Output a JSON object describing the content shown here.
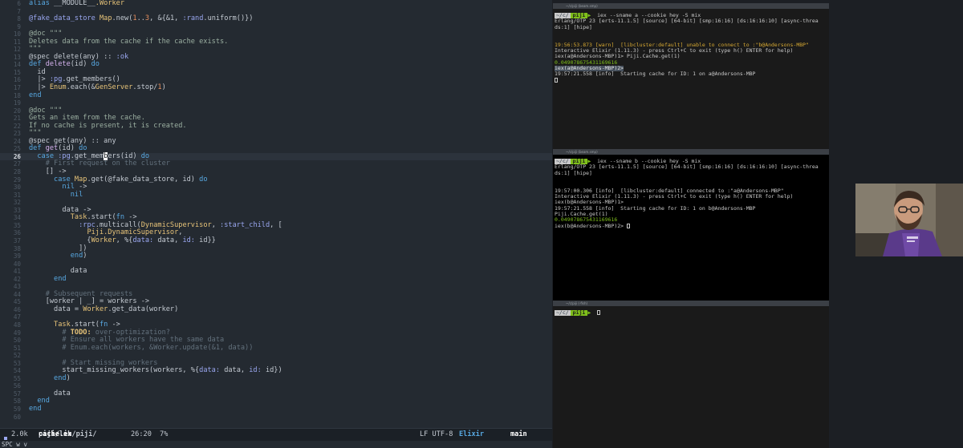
{
  "editor": {
    "lines": [
      {
        "n": "6",
        "t": [
          [
            "alias ",
            "kw"
          ],
          [
            "__MODULE__",
            ""
          ],
          [
            ".Worker",
            "mod"
          ]
        ]
      },
      {
        "n": "7",
        "t": []
      },
      {
        "n": "8",
        "t": [
          [
            "@fake_data_store ",
            "atom"
          ],
          [
            "Map",
            "mod"
          ],
          [
            ".new(",
            ""
          ],
          [
            "1",
            "num"
          ],
          [
            "..",
            ""
          ],
          [
            "3",
            "num"
          ],
          [
            ", &{&1, ",
            ""
          ],
          [
            ":rand",
            "atom"
          ],
          [
            ".uniform()})",
            ""
          ]
        ]
      },
      {
        "n": "9",
        "t": []
      },
      {
        "n": "10",
        "t": [
          [
            "@doc \"\"\"",
            "doc"
          ]
        ]
      },
      {
        "n": "11",
        "t": [
          [
            "Deletes data from the cache if the cache exists.",
            "doc"
          ]
        ]
      },
      {
        "n": "12",
        "t": [
          [
            "\"\"\"",
            "doc"
          ]
        ]
      },
      {
        "n": "13",
        "t": [
          [
            "@spec delete(any) :: ",
            ""
          ],
          [
            ":ok",
            "atom"
          ]
        ]
      },
      {
        "n": "14",
        "t": [
          [
            "def ",
            "kw"
          ],
          [
            "delete",
            "fn"
          ],
          [
            "(id) ",
            ""
          ],
          [
            "do",
            "kw"
          ]
        ]
      },
      {
        "n": "15",
        "t": [
          [
            "  id",
            ""
          ]
        ]
      },
      {
        "n": "16",
        "t": [
          [
            "  |> ",
            ""
          ],
          [
            ":pg",
            "atom"
          ],
          [
            ".get_members()",
            ""
          ]
        ]
      },
      {
        "n": "17",
        "t": [
          [
            "  |> ",
            ""
          ],
          [
            "Enum",
            "mod"
          ],
          [
            ".each(&",
            ""
          ],
          [
            "GenServer",
            "mod"
          ],
          [
            ".stop/",
            ""
          ],
          [
            "1",
            "num"
          ],
          [
            ")",
            ""
          ]
        ]
      },
      {
        "n": "18",
        "t": [
          [
            "end",
            "kw"
          ]
        ]
      },
      {
        "n": "19",
        "t": []
      },
      {
        "n": "20",
        "t": [
          [
            "@doc \"\"\"",
            "doc"
          ]
        ]
      },
      {
        "n": "21",
        "t": [
          [
            "Gets an item from the cache.",
            "doc"
          ]
        ]
      },
      {
        "n": "22",
        "t": [
          [
            "If no cache is present, it is created.",
            "doc"
          ]
        ]
      },
      {
        "n": "23",
        "t": [
          [
            "\"\"\"",
            "doc"
          ]
        ]
      },
      {
        "n": "24",
        "t": [
          [
            "@spec get(any) :: any",
            ""
          ]
        ]
      },
      {
        "n": "25",
        "t": [
          [
            "def ",
            "kw"
          ],
          [
            "get",
            "fn"
          ],
          [
            "(id) ",
            ""
          ],
          [
            "do",
            "kw"
          ]
        ]
      },
      {
        "n": "26",
        "cur": true,
        "t": [
          [
            "  case ",
            "kw"
          ],
          [
            ":pg",
            "atom"
          ],
          [
            ".get_mem",
            ""
          ],
          [
            "b",
            "cur"
          ],
          [
            "ers(id) ",
            ""
          ],
          [
            "do",
            "kw"
          ]
        ]
      },
      {
        "n": "27",
        "t": [
          [
            "    # First request on the cluster",
            "cm"
          ]
        ]
      },
      {
        "n": "28",
        "t": [
          [
            "    [] ->",
            ""
          ]
        ]
      },
      {
        "n": "29",
        "t": [
          [
            "      case ",
            "kw"
          ],
          [
            "Map",
            "mod"
          ],
          [
            ".get(@fake_data_store, id) ",
            ""
          ],
          [
            "do",
            "kw"
          ]
        ]
      },
      {
        "n": "30",
        "t": [
          [
            "        nil ",
            "kw"
          ],
          [
            "->",
            ""
          ]
        ]
      },
      {
        "n": "31",
        "t": [
          [
            "          nil",
            "kw"
          ]
        ]
      },
      {
        "n": "32",
        "t": []
      },
      {
        "n": "33",
        "t": [
          [
            "        data ->",
            ""
          ]
        ]
      },
      {
        "n": "34",
        "t": [
          [
            "          ",
            ""
          ],
          [
            "Task",
            "mod"
          ],
          [
            ".start(",
            ""
          ],
          [
            "fn ",
            "kw"
          ],
          [
            "->",
            ""
          ]
        ]
      },
      {
        "n": "35",
        "t": [
          [
            "            ",
            ""
          ],
          [
            ":rpc",
            "atom"
          ],
          [
            ".multicall(",
            ""
          ],
          [
            "DynamicSupervisor",
            "mod"
          ],
          [
            ", ",
            ""
          ],
          [
            ":start_child",
            "atom"
          ],
          [
            ", [",
            ""
          ]
        ]
      },
      {
        "n": "36",
        "t": [
          [
            "              ",
            ""
          ],
          [
            "Piji.DynamicSupervisor",
            "mod"
          ],
          [
            ",",
            ""
          ]
        ]
      },
      {
        "n": "37",
        "t": [
          [
            "              {",
            ""
          ],
          [
            "Worker",
            "mod"
          ],
          [
            ", %{",
            ""
          ],
          [
            "data:",
            "atom"
          ],
          [
            " data, ",
            ""
          ],
          [
            "id:",
            "atom"
          ],
          [
            " id}}",
            ""
          ]
        ]
      },
      {
        "n": "38",
        "t": [
          [
            "            ])",
            ""
          ]
        ]
      },
      {
        "n": "39",
        "t": [
          [
            "          ",
            ""
          ],
          [
            "end",
            "kw"
          ],
          [
            ")",
            ""
          ]
        ]
      },
      {
        "n": "40",
        "t": []
      },
      {
        "n": "41",
        "t": [
          [
            "          data",
            ""
          ]
        ]
      },
      {
        "n": "42",
        "t": [
          [
            "      ",
            ""
          ],
          [
            "end",
            "kw"
          ]
        ]
      },
      {
        "n": "43",
        "t": []
      },
      {
        "n": "44",
        "t": [
          [
            "    # Subsequent requests",
            "cm"
          ]
        ]
      },
      {
        "n": "45",
        "t": [
          [
            "    [worker | _] = workers ->",
            ""
          ]
        ]
      },
      {
        "n": "46",
        "t": [
          [
            "      data = ",
            ""
          ],
          [
            "Worker",
            "mod"
          ],
          [
            ".get_data(worker)",
            ""
          ]
        ]
      },
      {
        "n": "47",
        "t": []
      },
      {
        "n": "48",
        "t": [
          [
            "      ",
            ""
          ],
          [
            "Task",
            "mod"
          ],
          [
            ".start(",
            ""
          ],
          [
            "fn ",
            "kw"
          ],
          [
            "->",
            ""
          ]
        ]
      },
      {
        "n": "49",
        "t": [
          [
            "        # ",
            "cm"
          ],
          [
            "TODO:",
            "todo"
          ],
          [
            " over-optimization?",
            "cm"
          ]
        ]
      },
      {
        "n": "50",
        "t": [
          [
            "        # Ensure all workers have the same data",
            "cm"
          ]
        ]
      },
      {
        "n": "51",
        "t": [
          [
            "        # Enum.each(workers, &Worker.update(&1, data))",
            "cm"
          ]
        ]
      },
      {
        "n": "52",
        "t": []
      },
      {
        "n": "53",
        "t": [
          [
            "        # Start missing workers",
            "cm"
          ]
        ]
      },
      {
        "n": "54",
        "t": [
          [
            "        start_missing_workers(workers, %{",
            ""
          ],
          [
            "data:",
            "atom"
          ],
          [
            " data, ",
            ""
          ],
          [
            "id:",
            "atom"
          ],
          [
            " id})",
            ""
          ]
        ]
      },
      {
        "n": "55",
        "t": [
          [
            "      ",
            ""
          ],
          [
            "end",
            "kw"
          ],
          [
            ")",
            ""
          ]
        ]
      },
      {
        "n": "56",
        "t": []
      },
      {
        "n": "57",
        "t": [
          [
            "      data",
            ""
          ]
        ]
      },
      {
        "n": "58",
        "t": [
          [
            "  ",
            ""
          ],
          [
            "end",
            "kw"
          ]
        ]
      },
      {
        "n": "59",
        "t": [
          [
            "end",
            "kw"
          ]
        ]
      },
      {
        "n": "60",
        "t": []
      }
    ],
    "modeline": {
      "size": "2.0k",
      "path_dir": "piji/lib/piji/",
      "path_file": "cache.ex",
      "position": "26:20",
      "percent": "7%",
      "encoding": "LF UTF-8",
      "mode": "Elixir",
      "branch": "main"
    },
    "minibuffer": "SPC w v"
  },
  "terminals": [
    {
      "title": "~/c/piji (beam.smp)",
      "lines": [
        {
          "k": "prompt",
          "dir": "~/c/",
          "user": "piji",
          "cmd": "iex --sname a --cookie hey -S mix"
        },
        {
          "k": "text",
          "text": "Erlang/OTP 23 [erts-11.1.5] [source] [64-bit] [smp:16:16] [ds:16:16:10] [async-threa"
        },
        {
          "k": "text",
          "text": "ds:1] [hipe]"
        },
        {
          "k": "gap"
        },
        {
          "k": "gap"
        },
        {
          "k": "yellow",
          "text": "19:56:53.873 [warn]  [libcluster:default] unable to connect to :\"b@Andersons-MBP\""
        },
        {
          "k": "text",
          "text": "Interactive Elixir (1.11.3) - press Ctrl+C to exit (type h() ENTER for help)"
        },
        {
          "k": "text",
          "text": "iex(a@Andersons-MBP)1> Piji.Cache.get(1)"
        },
        {
          "k": "green",
          "text": "0.049078675431169616"
        },
        {
          "k": "sel",
          "text": "iex(a@Andersons-MBP)2>"
        },
        {
          "k": "text",
          "text": "19:57:21.558 [info]  Starting cache for ID: 1 on a@Andersons-MBP"
        },
        {
          "k": "cursor"
        }
      ]
    },
    {
      "title": "~/c/piji (beam.smp)",
      "lines": [
        {
          "k": "prompt",
          "dir": "~/c/",
          "user": "piji",
          "cmd": "iex --sname b --cookie hey -S mix"
        },
        {
          "k": "text",
          "text": "Erlang/OTP 23 [erts-11.1.5] [source] [64-bit] [smp:16:16] [ds:16:16:10] [async-threa"
        },
        {
          "k": "text",
          "text": "ds:1] [hipe]"
        },
        {
          "k": "gap"
        },
        {
          "k": "gap"
        },
        {
          "k": "text",
          "text": "19:57:00.306 [info]  [libcluster:default] connected to :\"a@Andersons-MBP\""
        },
        {
          "k": "text",
          "text": "Interactive Elixir (1.11.3) - press Ctrl+C to exit (type h() ENTER for help)"
        },
        {
          "k": "text",
          "text": "iex(b@Andersons-MBP)1>"
        },
        {
          "k": "text",
          "text": "19:57:21.558 [info]  Starting cache for ID: 1 on b@Andersons-MBP"
        },
        {
          "k": "text",
          "text": "Piji.Cache.get(1)"
        },
        {
          "k": "green",
          "text": "0.049078675431169616"
        },
        {
          "k": "textcursor",
          "text": "iex(b@Andersons-MBP)2> "
        }
      ]
    },
    {
      "title": "~/c/piji (-fish)",
      "lines": [
        {
          "k": "prompt",
          "dir": "~/c/",
          "user": "piji",
          "cmd": "",
          "cursor": true
        }
      ]
    }
  ]
}
